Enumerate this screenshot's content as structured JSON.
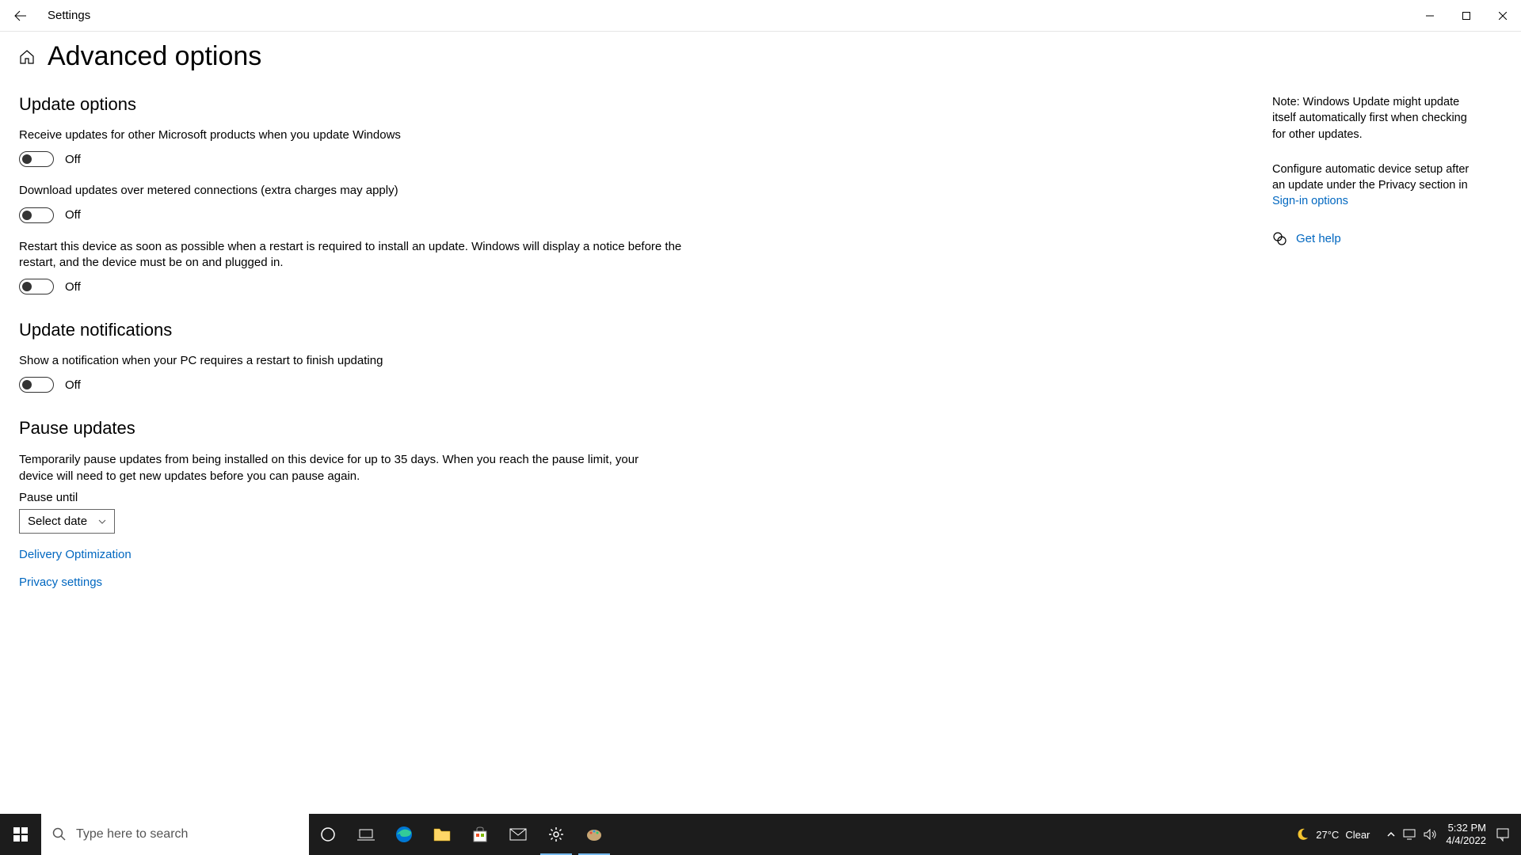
{
  "titlebar": {
    "app_name": "Settings"
  },
  "page": {
    "title": "Advanced options"
  },
  "sections": {
    "update_options": {
      "heading": "Update options",
      "opt1": {
        "desc": "Receive updates for other Microsoft products when you update Windows",
        "state": "Off"
      },
      "opt2": {
        "desc": "Download updates over metered connections (extra charges may apply)",
        "state": "Off"
      },
      "opt3": {
        "desc": "Restart this device as soon as possible when a restart is required to install an update. Windows will display a notice before the restart, and the device must be on and plugged in.",
        "state": "Off"
      }
    },
    "update_notifications": {
      "heading": "Update notifications",
      "opt1": {
        "desc": "Show a notification when your PC requires a restart to finish updating",
        "state": "Off"
      }
    },
    "pause_updates": {
      "heading": "Pause updates",
      "desc": "Temporarily pause updates from being installed on this device for up to 35 days. When you reach the pause limit, your device will need to get new updates before you can pause again.",
      "field_label": "Pause until",
      "dropdown_value": "Select date"
    },
    "links": {
      "delivery": "Delivery Optimization",
      "privacy": "Privacy settings"
    }
  },
  "side": {
    "note1": "Note: Windows Update might update itself automatically first when checking for other updates.",
    "note2_prefix": "Configure automatic device setup after an update under the Privacy section in ",
    "note2_link": "Sign-in options",
    "help": "Get help"
  },
  "taskbar": {
    "search_placeholder": "Type here to search",
    "weather_temp": "27°C",
    "weather_cond": "Clear",
    "time": "5:32 PM",
    "date": "4/4/2022"
  }
}
